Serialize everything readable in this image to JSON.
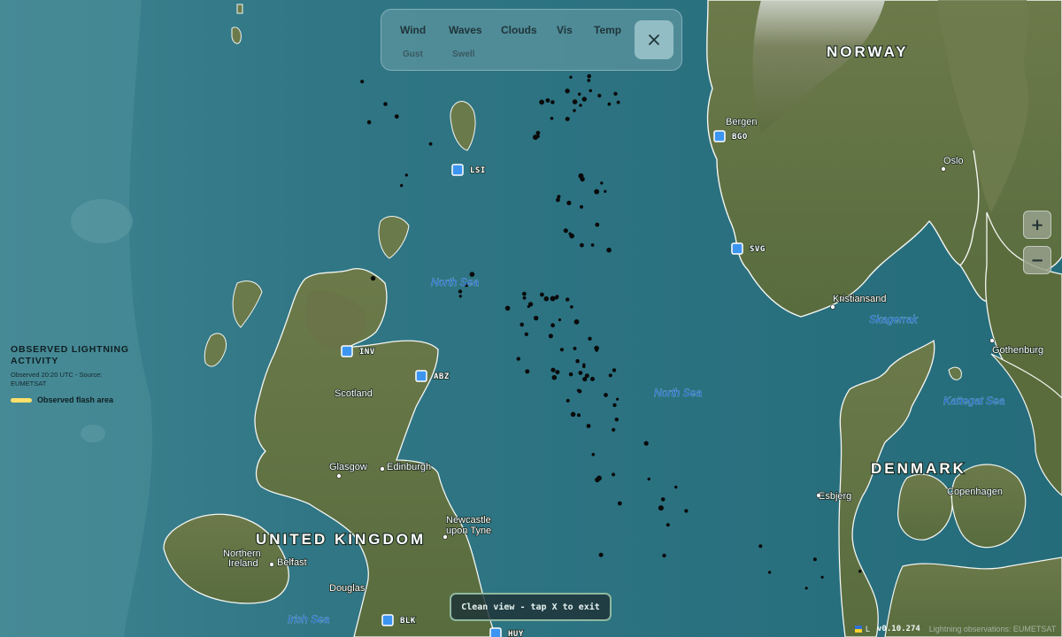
{
  "map": {
    "countries": [
      "NORWAY",
      "DENMARK",
      "UNITED KINGDOM"
    ],
    "seas": [
      "North Sea",
      "North Sea",
      "Skagerrak",
      "Kattegat Sea",
      "Irish Sea"
    ],
    "cities": [
      "Bergen",
      "Oslo",
      "Kristiansand",
      "Gothenburg",
      "Copenhagen",
      "Esbjerg",
      "Scotland",
      "Glasgow",
      "Edinburgh",
      "Newcastle",
      "upon Tyne",
      "Northern",
      "Ireland",
      "Belfast",
      "Douglas"
    ],
    "stations": [
      "LSI",
      "BGO",
      "SVG",
      "INV",
      "ABZ",
      "BLK",
      "HUY"
    ]
  },
  "layers": {
    "primary": [
      "Wind",
      "Waves",
      "Clouds",
      "Vis",
      "Temp"
    ],
    "secondary": [
      "Gust",
      "Swell"
    ],
    "close_icon": "close-icon"
  },
  "zoom": {
    "in_label": "+",
    "out_label": "−"
  },
  "legend": {
    "title": "OBSERVED LIGHTNING ACTIVITY",
    "subtitle": "Observed 20:20 UTC - Source: EUMETSAT",
    "item_label": "Observed flash area",
    "swatch_color": "#ffe06a"
  },
  "toast": "Clean view - tap X to exit",
  "footer": {
    "l_label": "L",
    "version": "v0.10.274",
    "attribution": "Lightning observations: EUMETSAT"
  },
  "colors": {
    "station": "#3d95f2",
    "sea": "#2b6f7c",
    "land": "#5f7446"
  }
}
